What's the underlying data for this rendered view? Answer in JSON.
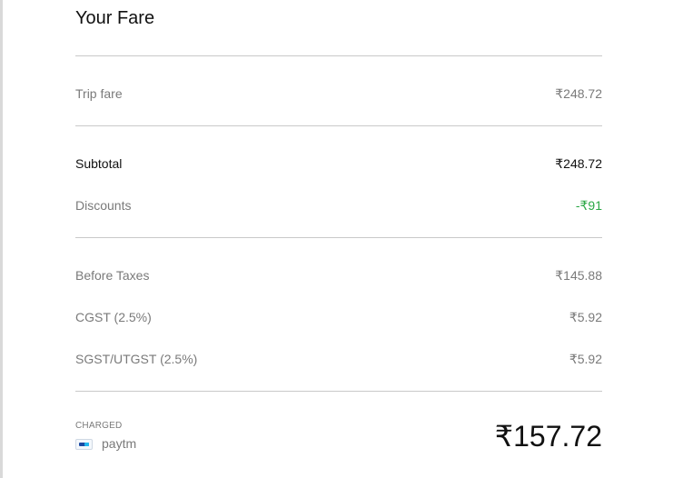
{
  "fare": {
    "title": "Your Fare",
    "trip_fare": {
      "label": "Trip fare",
      "value": "₹248.72"
    },
    "subtotal": {
      "label": "Subtotal",
      "value": "₹248.72"
    },
    "discounts": {
      "label": "Discounts",
      "value": "-₹91"
    },
    "before_taxes": {
      "label": "Before Taxes",
      "value": "₹145.88"
    },
    "cgst": {
      "label": "CGST (2.5%)",
      "value": "₹5.92"
    },
    "sgst": {
      "label": "SGST/UTGST (2.5%)",
      "value": "₹5.92"
    },
    "charged": {
      "label": "CHARGED",
      "payment_method": "paytm",
      "payment_icon": "paytm-icon",
      "total": "₹157.72"
    }
  },
  "colors": {
    "discount_green": "#2aa745",
    "divider": "#c9c9c9",
    "muted_text": "#7a7a7a"
  }
}
